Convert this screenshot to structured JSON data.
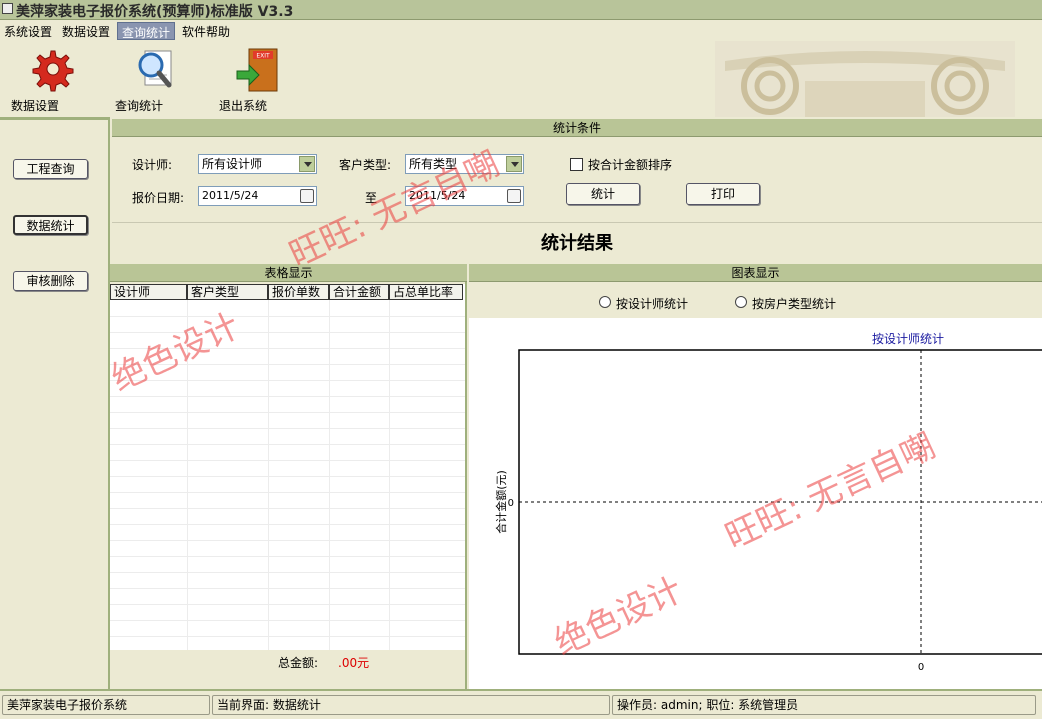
{
  "window": {
    "title": "美萍家装电子报价系统(预算师)标准版 V3.3"
  },
  "menu": [
    "系统设置",
    "数据设置",
    "查询统计",
    "软件帮助"
  ],
  "toolbar": {
    "buttons": [
      "数据设置",
      "查询统计",
      "退出系统"
    ],
    "exit_sign": "EXIT"
  },
  "left_nav": [
    "工程查询",
    "数据统计",
    "审核删除"
  ],
  "conditions": {
    "header": "统计条件",
    "designer_label": "设计师:",
    "designer_value": "所有设计师",
    "customer_type_label": "客户类型:",
    "customer_type_value": "所有类型",
    "sort_checkbox_label": "按合计金额排序",
    "date_label": "报价日期:",
    "date_from": "2011/5/24",
    "to_label": "至",
    "date_to": "2011/5/24",
    "stat_button": "统计",
    "print_button": "打印"
  },
  "result": {
    "title": "统计结果",
    "table_header": "表格显示",
    "columns": [
      "设计师",
      "客户类型",
      "报价单数",
      "合计金额",
      "占总单比率"
    ],
    "total_label": "总金额:",
    "total_value": ".00元"
  },
  "chart_panel": {
    "header": "图表显示",
    "radio_designer": "按设计师统计",
    "radio_house_type": "按房户类型统计"
  },
  "chart_data": {
    "type": "bar",
    "title": "按设计师统计",
    "ylabel": "合计金额(元)",
    "y_tick": "0",
    "x_tick": "0",
    "series": [],
    "grid": true
  },
  "status": {
    "app": "美萍家装电子报价系统",
    "current_view": "当前界面: 数据统计",
    "operator": "操作员: admin; 职位: 系统管理员"
  },
  "watermarks": [
    "旺旺: 无言自嘲",
    "绝色设计",
    "旺旺: 无言自嘲",
    "绝色设计"
  ],
  "colors": {
    "panel_header": "#b9c596",
    "accent_menu": "#8a95b0",
    "total_amount": "#dd0000",
    "chart_title": "#1a1aa0",
    "watermark": "#eb3c3c"
  }
}
